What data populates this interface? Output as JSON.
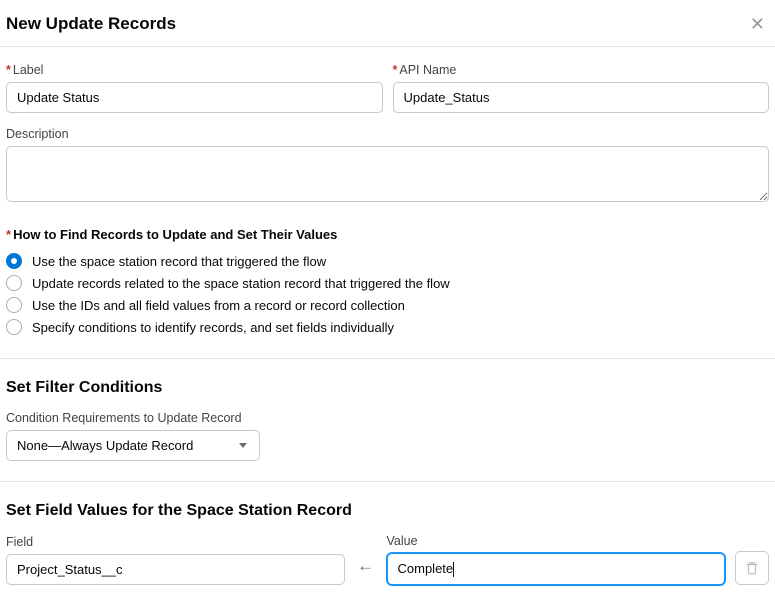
{
  "header": {
    "title": "New Update Records"
  },
  "fields": {
    "label_label": "Label",
    "label_value": "Update Status",
    "api_label": "API Name",
    "api_value": "Update_Status",
    "desc_label": "Description",
    "desc_value": ""
  },
  "howto": {
    "heading": "How to Find Records to Update and Set Their Values",
    "options": [
      "Use the space station record that triggered the flow",
      "Update records related to the space station record that triggered the flow",
      "Use the IDs and all field values from a record or record collection",
      "Specify conditions to identify records, and set fields individually"
    ]
  },
  "filter": {
    "heading": "Set Filter Conditions",
    "req_label": "Condition Requirements to Update Record",
    "selected": "None—Always Update Record"
  },
  "setvalues": {
    "heading": "Set Field Values for the Space Station Record",
    "field_label": "Field",
    "field_value": "Project_Status__c",
    "value_label": "Value",
    "value_value": "Complete"
  }
}
